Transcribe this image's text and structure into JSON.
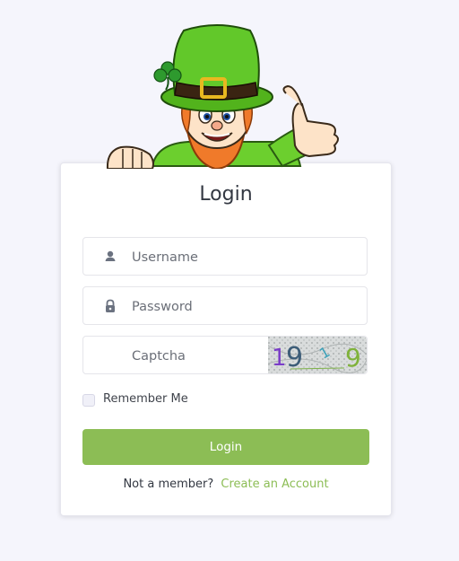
{
  "login": {
    "title": "Login",
    "username": {
      "placeholder": "Username",
      "value": ""
    },
    "password": {
      "placeholder": "Password",
      "value": ""
    },
    "captcha": {
      "placeholder": "Captcha",
      "value": "",
      "image_text": "1919"
    },
    "remember_label": "Remember Me",
    "remember_checked": false,
    "submit_label": "Login",
    "footer_text": "Not a member?",
    "signup_link": "Create an Account"
  },
  "colors": {
    "accent": "#8cbd55",
    "page_bg": "#f5f5fc",
    "card_bg": "#ffffff"
  },
  "icons": {
    "username": "user-icon",
    "password": "lock-icon",
    "mascot": "leprechaun-illustration"
  }
}
